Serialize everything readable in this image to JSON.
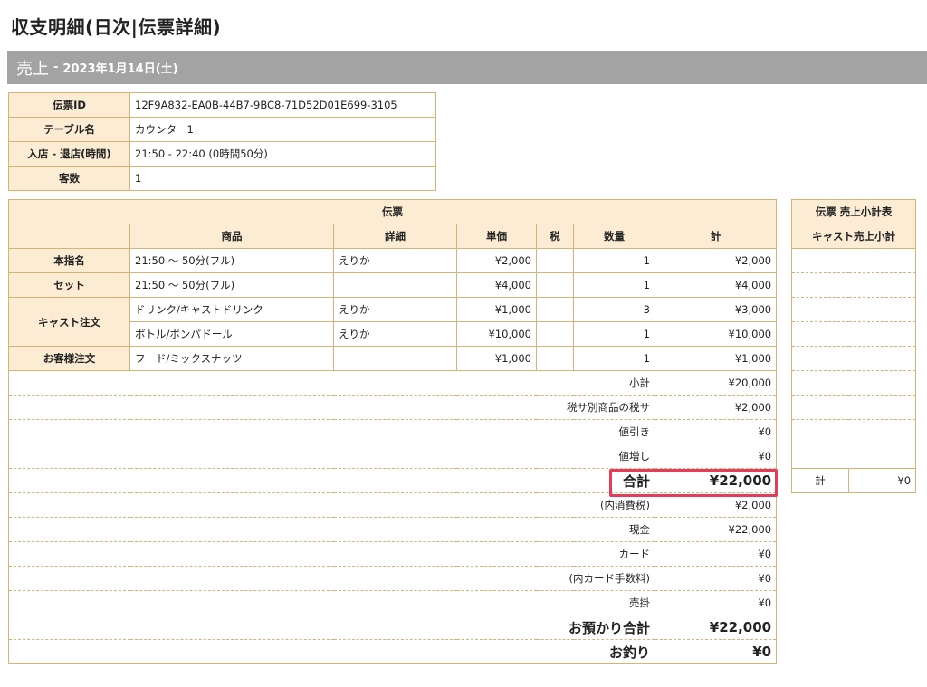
{
  "page": {
    "title": "収支明細(日次|伝票詳細)"
  },
  "section": {
    "label": "売上",
    "separator": "-",
    "date": "2023年1月14日(土)"
  },
  "info": {
    "rows": [
      {
        "label": "伝票ID",
        "value": "12F9A832-EA0B-44B7-9BC8-71D52D01E699-3105"
      },
      {
        "label": "テーブル名",
        "value": "カウンター1"
      },
      {
        "label": "入店 - 退店(時間)",
        "value": "21:50 - 22:40 (0時間50分)"
      },
      {
        "label": "客数",
        "value": "1"
      }
    ]
  },
  "slip": {
    "title": "伝票",
    "headers": {
      "product": "商品",
      "detail": "詳細",
      "unit_price": "単価",
      "tax": "税",
      "qty": "数量",
      "total": "計"
    },
    "rows": [
      {
        "category": "本指名",
        "product": "21:50 〜 50分(フル)",
        "detail": "えりか",
        "unit_price": "¥2,000",
        "tax": "",
        "qty": "1",
        "total": "¥2,000"
      },
      {
        "category": "セット",
        "product": "21:50 〜 50分(フル)",
        "detail": "",
        "unit_price": "¥4,000",
        "tax": "",
        "qty": "1",
        "total": "¥4,000"
      },
      {
        "category": "キャスト注文",
        "product": "ドリンク/キャストドリンク",
        "detail": "えりか",
        "unit_price": "¥1,000",
        "tax": "",
        "qty": "3",
        "total": "¥3,000"
      },
      {
        "category": "",
        "product": "ボトル/ポンパドール",
        "detail": "えりか",
        "unit_price": "¥10,000",
        "tax": "",
        "qty": "1",
        "total": "¥10,000"
      },
      {
        "category": "お客様注文",
        "product": "フード/ミックスナッツ",
        "detail": "",
        "unit_price": "¥1,000",
        "tax": "",
        "qty": "1",
        "total": "¥1,000"
      }
    ],
    "summary": [
      {
        "label": "小計",
        "value": "¥20,000"
      },
      {
        "label": "税サ別商品の税サ",
        "value": "¥2,000"
      },
      {
        "label": "値引き",
        "value": "¥0"
      },
      {
        "label": "値増し",
        "value": "¥0"
      },
      {
        "label": "合計",
        "value": "¥22,000"
      },
      {
        "label": "(内消費税)",
        "value": "¥2,000"
      },
      {
        "label": "現金",
        "value": "¥22,000"
      },
      {
        "label": "カード",
        "value": "¥0"
      },
      {
        "label": "(内カード手数料)",
        "value": "¥0"
      },
      {
        "label": "売掛",
        "value": "¥0"
      },
      {
        "label": "お預かり合計",
        "value": "¥22,000"
      },
      {
        "label": "お釣り",
        "value": "¥0"
      }
    ]
  },
  "cast_summary": {
    "title": "伝票 売上小計表",
    "subtitle": "キャスト売上小計",
    "total_label": "計",
    "total_value": "¥0"
  },
  "colors": {
    "header_bg": "#fbecd3",
    "border": "#d9b275",
    "section_bar": "#a3a3a3",
    "highlight": "#e63c5b"
  }
}
